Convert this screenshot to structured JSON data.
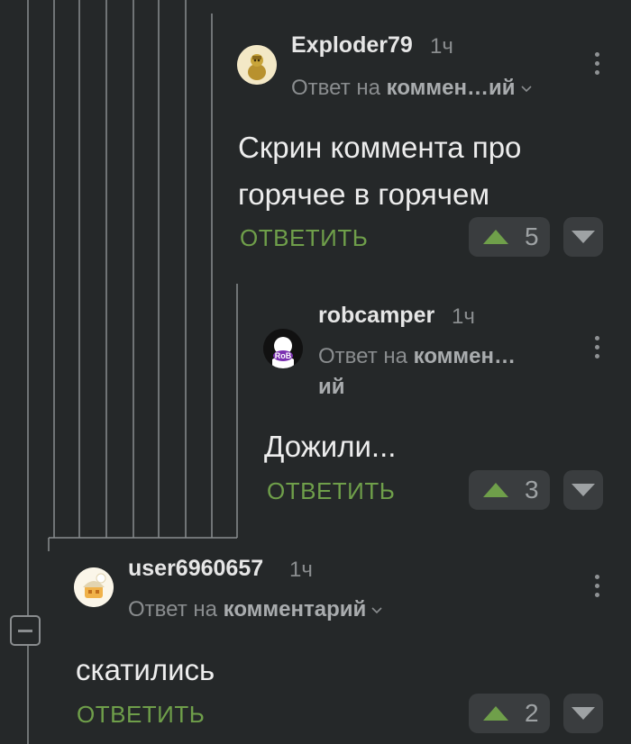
{
  "comments": [
    {
      "username": "Exploder79",
      "time": "1ч",
      "reply_prefix": "Ответ на",
      "reply_target": "коммен…ий",
      "text_lines": [
        "Скрин коммента про",
        "горячее в горячем"
      ],
      "reply_label": "ОТВЕТИТЬ",
      "rating": "5"
    },
    {
      "username": "robcamper",
      "time": "1ч",
      "reply_prefix": "Ответ на",
      "reply_target_line1": "коммен…",
      "reply_target_line2": "ий",
      "text_lines": [
        "Дожили..."
      ],
      "reply_label": "ОТВЕТИТЬ",
      "rating": "3",
      "avatar_text": "RoB"
    },
    {
      "username": "user6960657",
      "time": "1ч",
      "reply_prefix": "Ответ на",
      "reply_target": "комментарий",
      "text_lines": [
        "скатились"
      ],
      "reply_label": "ОТВЕТИТЬ",
      "rating": "2"
    }
  ],
  "colors": {
    "background": "#252829",
    "accent_green": "#6f9f4a",
    "vote_box": "#3a3d3f"
  },
  "icons": [
    "chevron-down-icon",
    "upvote-icon",
    "downvote-icon",
    "more-vertical-icon",
    "collapse-icon"
  ]
}
